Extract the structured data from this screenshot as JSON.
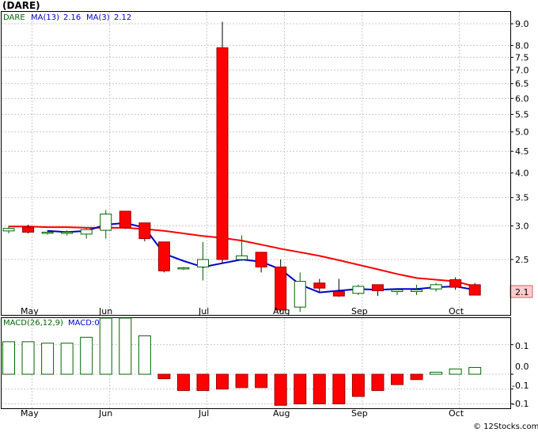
{
  "chart_data": {
    "type": "candlestick",
    "title": "(DARE)",
    "ticker": "DARE",
    "ma_legend": {
      "ma13_label": "MA(13)",
      "ma13_value": "2.16",
      "ma3_label": "MA(3)",
      "ma3_value": "2.12"
    },
    "last_price_tag": "2.1",
    "price_axis": {
      "scale": "log",
      "ylim": [
        1.85,
        9.6
      ],
      "ticks": [
        "9.0",
        "8.0",
        "7.5",
        "7.0",
        "6.5",
        "6.0",
        "5.5",
        "5.0",
        "4.5",
        "4.0",
        "3.5",
        "3.0",
        "2.5"
      ]
    },
    "months": [
      {
        "label": "May",
        "week": 1.2
      },
      {
        "label": "Jun",
        "week": 5.2
      },
      {
        "label": "Jul",
        "week": 10.2
      },
      {
        "label": "Aug",
        "week": 14.2
      },
      {
        "label": "Sep",
        "week": 18.2
      },
      {
        "label": "Oct",
        "week": 23.2
      }
    ],
    "candles": [
      {
        "o": 2.92,
        "h": 3.0,
        "l": 2.88,
        "c": 2.96
      },
      {
        "o": 2.98,
        "h": 3.02,
        "l": 2.88,
        "c": 2.9
      },
      {
        "o": 2.89,
        "h": 2.93,
        "l": 2.86,
        "c": 2.9
      },
      {
        "o": 2.88,
        "h": 2.93,
        "l": 2.85,
        "c": 2.9
      },
      {
        "o": 2.87,
        "h": 2.97,
        "l": 2.8,
        "c": 2.94
      },
      {
        "o": 2.93,
        "h": 3.27,
        "l": 2.8,
        "c": 3.2
      },
      {
        "o": 3.25,
        "h": 3.25,
        "l": 2.95,
        "c": 2.97
      },
      {
        "o": 3.05,
        "h": 3.05,
        "l": 2.76,
        "c": 2.8
      },
      {
        "o": 2.75,
        "h": 2.75,
        "l": 2.33,
        "c": 2.35
      },
      {
        "o": 2.38,
        "h": 2.4,
        "l": 2.36,
        "c": 2.39
      },
      {
        "o": 2.4,
        "h": 2.75,
        "l": 2.23,
        "c": 2.5
      },
      {
        "o": 7.9,
        "h": 9.1,
        "l": 2.45,
        "c": 2.5
      },
      {
        "o": 2.5,
        "h": 2.85,
        "l": 2.48,
        "c": 2.55
      },
      {
        "o": 2.6,
        "h": 2.6,
        "l": 2.33,
        "c": 2.4
      },
      {
        "o": 2.4,
        "h": 2.5,
        "l": 1.88,
        "c": 1.9
      },
      {
        "o": 1.93,
        "h": 2.33,
        "l": 1.88,
        "c": 2.22
      },
      {
        "o": 2.2,
        "h": 2.25,
        "l": 2.1,
        "c": 2.14
      },
      {
        "o": 2.1,
        "h": 2.25,
        "l": 2.04,
        "c": 2.05
      },
      {
        "o": 2.08,
        "h": 2.18,
        "l": 2.06,
        "c": 2.16
      },
      {
        "o": 2.18,
        "h": 2.18,
        "l": 2.05,
        "c": 2.11
      },
      {
        "o": 2.1,
        "h": 2.14,
        "l": 2.06,
        "c": 2.12
      },
      {
        "o": 2.1,
        "h": 2.18,
        "l": 2.06,
        "c": 2.12
      },
      {
        "o": 2.13,
        "h": 2.2,
        "l": 2.1,
        "c": 2.18
      },
      {
        "o": 2.24,
        "h": 2.27,
        "l": 2.12,
        "c": 2.15
      },
      {
        "o": 2.18,
        "h": 2.2,
        "l": 2.06,
        "c": 2.06
      }
    ],
    "ma3": [
      null,
      null,
      2.92,
      2.9,
      2.92,
      3.02,
      3.05,
      2.97,
      2.58,
      2.48,
      2.4,
      2.45,
      2.5,
      2.47,
      2.37,
      2.18,
      2.09,
      2.11,
      2.13,
      2.12,
      2.13,
      2.13,
      2.15,
      2.16,
      2.12
    ],
    "ma13": [
      2.99,
      2.99,
      2.98,
      2.98,
      2.97,
      2.97,
      2.97,
      2.95,
      2.92,
      2.88,
      2.84,
      2.81,
      2.77,
      2.71,
      2.65,
      2.6,
      2.55,
      2.49,
      2.43,
      2.37,
      2.31,
      2.26,
      2.24,
      2.22,
      2.16
    ],
    "macd_panel": {
      "label": "MACD(26,12,9)",
      "value_label": "MACD:0.02",
      "ylim": [
        -0.115,
        0.19
      ],
      "ticks": [
        "0.1",
        "0.0",
        "-0.1",
        "-0.1"
      ],
      "tick_values": [
        0.1,
        0.0,
        -0.05,
        -0.1
      ],
      "histogram": [
        0.11,
        0.11,
        0.105,
        0.105,
        0.125,
        0.19,
        0.19,
        0.13,
        -0.015,
        -0.055,
        -0.055,
        -0.05,
        -0.045,
        -0.045,
        -0.105,
        -0.1,
        -0.1,
        -0.1,
        -0.075,
        -0.055,
        -0.035,
        -0.018,
        0.007,
        0.018,
        0.023
      ]
    },
    "watermark": "© 12Stocks.com",
    "colors": {
      "up_fill": "#ffffff",
      "up_stroke": "#006600",
      "down_fill": "#ff0000",
      "down_stroke": "#990000",
      "ma3": "#0000cc",
      "ma13": "#ff0000",
      "grid": "#c8c8c8",
      "hist_pos_stroke": "#006600",
      "hist_neg": "#ff0000",
      "tag_fill": "#ffcccc"
    }
  }
}
